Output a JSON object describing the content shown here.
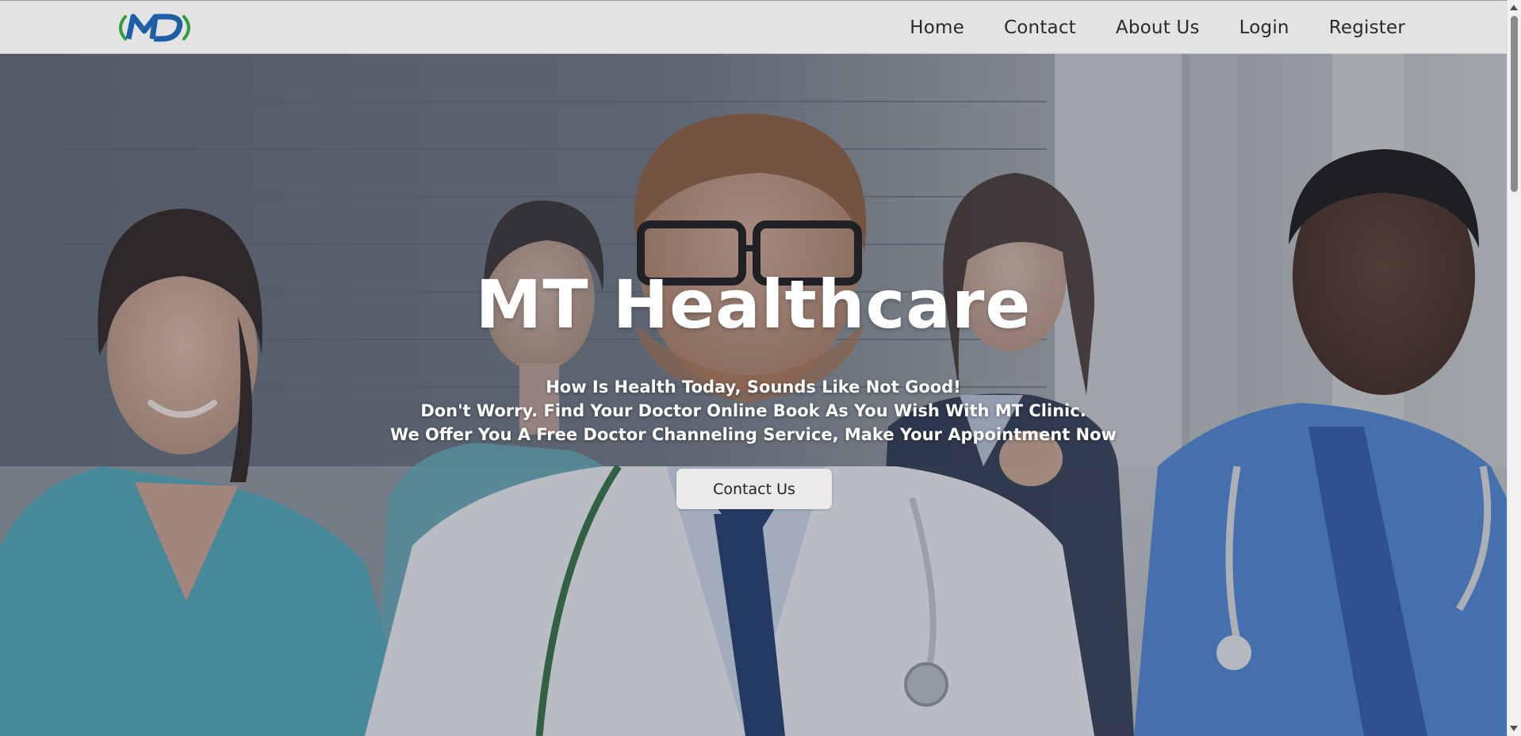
{
  "navbar": {
    "logo_text": "MD",
    "links": [
      {
        "label": "Home"
      },
      {
        "label": "Contact"
      },
      {
        "label": "About Us"
      },
      {
        "label": "Login"
      },
      {
        "label": "Register"
      }
    ]
  },
  "hero": {
    "title": "MT Healthcare",
    "subtitle_lines": [
      "How Is Health Today, Sounds Like Not Good!",
      "Don't Worry. Find Your Doctor Online Book As You Wish With MT Clinic.",
      "We Offer You A Free Doctor Channeling Service, Make Your Appointment Now"
    ],
    "cta_label": "Contact Us"
  },
  "colors": {
    "navbar_bg": "#e3e3e3",
    "logo_green": "#2e9e3f",
    "logo_blue": "#1f5fa8",
    "button_bg": "#ebe9ea"
  },
  "icons": {
    "logo": "md-logo-icon",
    "scroll_up": "scroll-up-arrow-icon",
    "scroll_down": "scroll-down-arrow-icon"
  }
}
